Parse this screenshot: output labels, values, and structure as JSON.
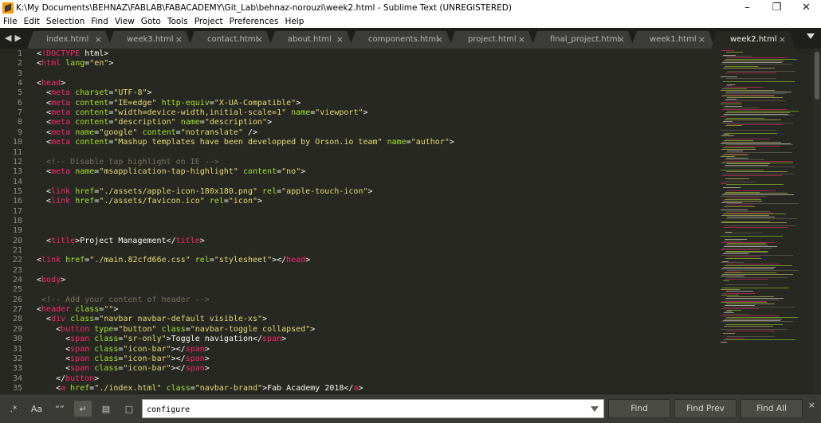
{
  "window": {
    "title": "K:\\My Documents\\BEHNAZ\\FABLAB\\FABACADEMY\\Git_Lab\\behnaz-norouzi\\week2.html - Sublime Text (UNREGISTERED)",
    "minimize": "–",
    "maximize": "❐",
    "close": "✕"
  },
  "menu": [
    "File",
    "Edit",
    "Selection",
    "Find",
    "View",
    "Goto",
    "Tools",
    "Project",
    "Preferences",
    "Help"
  ],
  "tabs": [
    {
      "label": "index.html",
      "active": false
    },
    {
      "label": "week3.html",
      "active": false
    },
    {
      "label": "contact.html",
      "active": false
    },
    {
      "label": "about.html",
      "active": false
    },
    {
      "label": "components.html",
      "active": false
    },
    {
      "label": "project.html",
      "active": false
    },
    {
      "label": "final_project.html",
      "active": false
    },
    {
      "label": "week1.html",
      "active": false
    },
    {
      "label": "week2.html",
      "active": true
    }
  ],
  "tab_close_glyph": "×",
  "tab_nav": {
    "prev": "◀",
    "next": "▶"
  },
  "code_lines": [
    {
      "n": "1",
      "tokens": [
        [
          "w",
          "<"
        ],
        [
          "t",
          "!DOCTYPE"
        ],
        [
          "w",
          " html>"
        ]
      ]
    },
    {
      "n": "2",
      "tokens": [
        [
          "w",
          "<"
        ],
        [
          "t",
          "html"
        ],
        [
          "w",
          " "
        ],
        [
          "a",
          "lang"
        ],
        [
          "w",
          "="
        ],
        [
          "s",
          "\"en\""
        ],
        [
          "w",
          ">"
        ]
      ]
    },
    {
      "n": "3",
      "tokens": []
    },
    {
      "n": "4",
      "tokens": [
        [
          "w",
          "<"
        ],
        [
          "t",
          "head"
        ],
        [
          "w",
          ">"
        ]
      ]
    },
    {
      "n": "5",
      "tokens": [
        [
          "w",
          "  <"
        ],
        [
          "t",
          "meta"
        ],
        [
          "w",
          " "
        ],
        [
          "a",
          "charset"
        ],
        [
          "w",
          "="
        ],
        [
          "s",
          "\"UTF-8\""
        ],
        [
          "w",
          ">"
        ]
      ]
    },
    {
      "n": "6",
      "tokens": [
        [
          "w",
          "  <"
        ],
        [
          "t",
          "meta"
        ],
        [
          "w",
          " "
        ],
        [
          "a",
          "content"
        ],
        [
          "w",
          "="
        ],
        [
          "s",
          "\"IE=edge\""
        ],
        [
          "w",
          " "
        ],
        [
          "a",
          "http-equiv"
        ],
        [
          "w",
          "="
        ],
        [
          "s",
          "\"X-UA-Compatible\""
        ],
        [
          "w",
          ">"
        ]
      ]
    },
    {
      "n": "7",
      "tokens": [
        [
          "w",
          "  <"
        ],
        [
          "t",
          "meta"
        ],
        [
          "w",
          " "
        ],
        [
          "a",
          "content"
        ],
        [
          "w",
          "="
        ],
        [
          "s",
          "\"width=device-width,initial-scale=1\""
        ],
        [
          "w",
          " "
        ],
        [
          "a",
          "name"
        ],
        [
          "w",
          "="
        ],
        [
          "s",
          "\"viewport\""
        ],
        [
          "w",
          ">"
        ]
      ]
    },
    {
      "n": "8",
      "tokens": [
        [
          "w",
          "  <"
        ],
        [
          "t",
          "meta"
        ],
        [
          "w",
          " "
        ],
        [
          "a",
          "content"
        ],
        [
          "w",
          "="
        ],
        [
          "s",
          "\"description\""
        ],
        [
          "w",
          " "
        ],
        [
          "a",
          "name"
        ],
        [
          "w",
          "="
        ],
        [
          "s",
          "\"description\""
        ],
        [
          "w",
          ">"
        ]
      ]
    },
    {
      "n": "9",
      "tokens": [
        [
          "w",
          "  <"
        ],
        [
          "t",
          "meta"
        ],
        [
          "w",
          " "
        ],
        [
          "a",
          "name"
        ],
        [
          "w",
          "="
        ],
        [
          "s",
          "\"google\""
        ],
        [
          "w",
          " "
        ],
        [
          "a",
          "content"
        ],
        [
          "w",
          "="
        ],
        [
          "s",
          "\"notranslate\""
        ],
        [
          "w",
          " />"
        ]
      ]
    },
    {
      "n": "10",
      "tokens": [
        [
          "w",
          "  <"
        ],
        [
          "t",
          "meta"
        ],
        [
          "w",
          " "
        ],
        [
          "a",
          "content"
        ],
        [
          "w",
          "="
        ],
        [
          "s",
          "\"Mashup templates have been developped by Orson.io team\""
        ],
        [
          "w",
          " "
        ],
        [
          "a",
          "name"
        ],
        [
          "w",
          "="
        ],
        [
          "s",
          "\"author\""
        ],
        [
          "w",
          ">"
        ]
      ]
    },
    {
      "n": "11",
      "tokens": []
    },
    {
      "n": "12",
      "tokens": [
        [
          "c",
          "  <!-- Disable tap highlight on IE -->"
        ]
      ]
    },
    {
      "n": "13",
      "tokens": [
        [
          "w",
          "  <"
        ],
        [
          "t",
          "meta"
        ],
        [
          "w",
          " "
        ],
        [
          "a",
          "name"
        ],
        [
          "w",
          "="
        ],
        [
          "s",
          "\"msapplication-tap-highlight\""
        ],
        [
          "w",
          " "
        ],
        [
          "a",
          "content"
        ],
        [
          "w",
          "="
        ],
        [
          "s",
          "\"no\""
        ],
        [
          "w",
          ">"
        ]
      ]
    },
    {
      "n": "14",
      "tokens": []
    },
    {
      "n": "15",
      "tokens": [
        [
          "w",
          "  <"
        ],
        [
          "t",
          "link"
        ],
        [
          "w",
          " "
        ],
        [
          "a",
          "href"
        ],
        [
          "w",
          "="
        ],
        [
          "s",
          "\"./assets/apple-icon-180x180.png\""
        ],
        [
          "w",
          " "
        ],
        [
          "a",
          "rel"
        ],
        [
          "w",
          "="
        ],
        [
          "s",
          "\"apple-touch-icon\""
        ],
        [
          "w",
          ">"
        ]
      ]
    },
    {
      "n": "16",
      "tokens": [
        [
          "w",
          "  <"
        ],
        [
          "t",
          "link"
        ],
        [
          "w",
          " "
        ],
        [
          "a",
          "href"
        ],
        [
          "w",
          "="
        ],
        [
          "s",
          "\"./assets/favicon.ico\""
        ],
        [
          "w",
          " "
        ],
        [
          "a",
          "rel"
        ],
        [
          "w",
          "="
        ],
        [
          "s",
          "\"icon\""
        ],
        [
          "w",
          ">"
        ]
      ]
    },
    {
      "n": "17",
      "tokens": []
    },
    {
      "n": "18",
      "tokens": []
    },
    {
      "n": "19",
      "tokens": []
    },
    {
      "n": "20",
      "tokens": [
        [
          "w",
          "  <"
        ],
        [
          "t",
          "title"
        ],
        [
          "w",
          ">Project Management</"
        ],
        [
          "t",
          "title"
        ],
        [
          "w",
          ">"
        ]
      ]
    },
    {
      "n": "21",
      "tokens": []
    },
    {
      "n": "22",
      "tokens": [
        [
          "w",
          "<"
        ],
        [
          "t",
          "link"
        ],
        [
          "w",
          " "
        ],
        [
          "a",
          "href"
        ],
        [
          "w",
          "="
        ],
        [
          "s",
          "\"./main.82cfd66e.css\""
        ],
        [
          "w",
          " "
        ],
        [
          "a",
          "rel"
        ],
        [
          "w",
          "="
        ],
        [
          "s",
          "\"stylesheet\""
        ],
        [
          "w",
          "></"
        ],
        [
          "t",
          "head"
        ],
        [
          "w",
          ">"
        ]
      ]
    },
    {
      "n": "23",
      "tokens": []
    },
    {
      "n": "24",
      "tokens": [
        [
          "w",
          "<"
        ],
        [
          "t",
          "body"
        ],
        [
          "w",
          ">"
        ]
      ]
    },
    {
      "n": "25",
      "tokens": []
    },
    {
      "n": "26",
      "tokens": [
        [
          "c",
          " <!-- Add your content of header -->"
        ]
      ]
    },
    {
      "n": "27",
      "tokens": [
        [
          "w",
          "<"
        ],
        [
          "t",
          "header"
        ],
        [
          "w",
          " "
        ],
        [
          "a",
          "class"
        ],
        [
          "w",
          "="
        ],
        [
          "s",
          "\"\""
        ],
        [
          "w",
          ">"
        ]
      ]
    },
    {
      "n": "28",
      "tokens": [
        [
          "w",
          "  <"
        ],
        [
          "t",
          "div"
        ],
        [
          "w",
          " "
        ],
        [
          "a",
          "class"
        ],
        [
          "w",
          "="
        ],
        [
          "s",
          "\"navbar navbar-default visible-xs\""
        ],
        [
          "w",
          ">"
        ]
      ]
    },
    {
      "n": "29",
      "tokens": [
        [
          "w",
          "    <"
        ],
        [
          "t",
          "button"
        ],
        [
          "w",
          " "
        ],
        [
          "a",
          "type"
        ],
        [
          "w",
          "="
        ],
        [
          "s",
          "\"button\""
        ],
        [
          "w",
          " "
        ],
        [
          "a",
          "class"
        ],
        [
          "w",
          "="
        ],
        [
          "s",
          "\"navbar-toggle collapsed\""
        ],
        [
          "w",
          ">"
        ]
      ]
    },
    {
      "n": "30",
      "tokens": [
        [
          "w",
          "      <"
        ],
        [
          "t",
          "span"
        ],
        [
          "w",
          " "
        ],
        [
          "a",
          "class"
        ],
        [
          "w",
          "="
        ],
        [
          "s",
          "\"sr-only\""
        ],
        [
          "w",
          ">Toggle navigation</"
        ],
        [
          "t",
          "span"
        ],
        [
          "w",
          ">"
        ]
      ]
    },
    {
      "n": "31",
      "tokens": [
        [
          "w",
          "      <"
        ],
        [
          "t",
          "span"
        ],
        [
          "w",
          " "
        ],
        [
          "a",
          "class"
        ],
        [
          "w",
          "="
        ],
        [
          "s",
          "\"icon-bar\""
        ],
        [
          "w",
          "></"
        ],
        [
          "t",
          "span"
        ],
        [
          "w",
          ">"
        ]
      ]
    },
    {
      "n": "32",
      "tokens": [
        [
          "w",
          "      <"
        ],
        [
          "t",
          "span"
        ],
        [
          "w",
          " "
        ],
        [
          "a",
          "class"
        ],
        [
          "w",
          "="
        ],
        [
          "s",
          "\"icon-bar\""
        ],
        [
          "w",
          "></"
        ],
        [
          "t",
          "span"
        ],
        [
          "w",
          ">"
        ]
      ]
    },
    {
      "n": "33",
      "tokens": [
        [
          "w",
          "      <"
        ],
        [
          "t",
          "span"
        ],
        [
          "w",
          " "
        ],
        [
          "a",
          "class"
        ],
        [
          "w",
          "="
        ],
        [
          "s",
          "\"icon-bar\""
        ],
        [
          "w",
          "></"
        ],
        [
          "t",
          "span"
        ],
        [
          "w",
          ">"
        ]
      ]
    },
    {
      "n": "34",
      "tokens": [
        [
          "w",
          "    </"
        ],
        [
          "t",
          "button"
        ],
        [
          "w",
          ">"
        ]
      ]
    },
    {
      "n": "35",
      "tokens": [
        [
          "w",
          "    <"
        ],
        [
          "t",
          "a"
        ],
        [
          "w",
          " "
        ],
        [
          "a",
          "href"
        ],
        [
          "w",
          "="
        ],
        [
          "s",
          "\"./index.html\""
        ],
        [
          "w",
          " "
        ],
        [
          "a",
          "class"
        ],
        [
          "w",
          "="
        ],
        [
          "s",
          "\"navbar-brand\""
        ],
        [
          "w",
          ">Fab Academy 2018</"
        ],
        [
          "t",
          "a"
        ],
        [
          "w",
          ">"
        ]
      ]
    }
  ],
  "colors": {
    "background": "#272822",
    "tag": "#f92672",
    "attribute": "#a6e22e",
    "string": "#e6db74",
    "comment": "#75715e",
    "text": "#f8f8f2"
  },
  "find_panel": {
    "options": [
      {
        "icon": "regex-icon",
        "glyph": ".*",
        "on": false
      },
      {
        "icon": "case-sensitive-icon",
        "glyph": "Aa",
        "on": false
      },
      {
        "icon": "whole-word-icon",
        "glyph": "“”",
        "on": false
      },
      {
        "icon": "wrap-icon",
        "glyph": "↵",
        "on": true
      },
      {
        "icon": "in-selection-icon",
        "glyph": "▤",
        "on": false
      },
      {
        "icon": "highlight-matches-icon",
        "glyph": "□",
        "on": false
      }
    ],
    "query": "configure",
    "buttons": {
      "find": "Find",
      "find_prev": "Find Prev",
      "find_all": "Find All"
    },
    "close": "×"
  }
}
